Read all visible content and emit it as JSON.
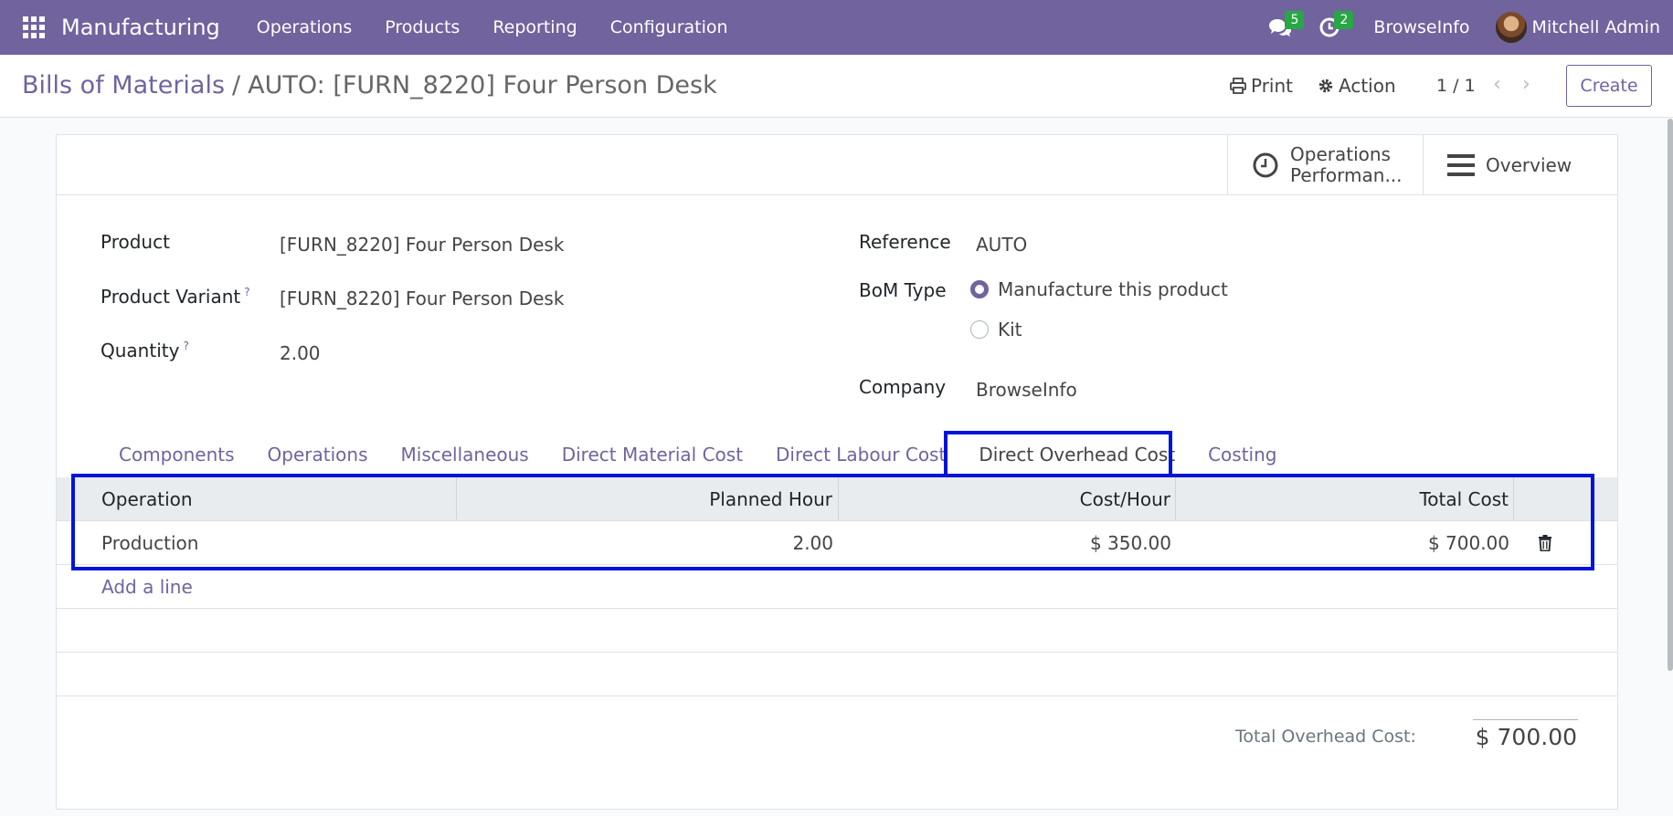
{
  "navbar": {
    "app_name": "Manufacturing",
    "menu": [
      "Operations",
      "Products",
      "Reporting",
      "Configuration"
    ],
    "messages_count": "5",
    "activities_count": "2",
    "company": "BrowseInfo",
    "user": "Mitchell Admin",
    "bg_color": "#71639e"
  },
  "control_panel": {
    "breadcrumb_parent": "Bills of Materials",
    "breadcrumb_separator": "/",
    "breadcrumb_current": "AUTO: [FURN_8220] Four Person Desk",
    "print_label": "Print",
    "action_label": "Action",
    "pager": "1 / 1",
    "create_label": "Create"
  },
  "button_box": {
    "operations_performance_line1": "Operations",
    "operations_performance_line2": "Performan...",
    "overview_label": "Overview"
  },
  "form": {
    "product_label": "Product",
    "product_value": "[FURN_8220] Four Person Desk",
    "variant_label": "Product Variant",
    "variant_value": "[FURN_8220] Four Person Desk",
    "quantity_label": "Quantity",
    "quantity_value": "2.00",
    "help_mark": "?",
    "reference_label": "Reference",
    "reference_value": "AUTO",
    "bom_type_label": "BoM Type",
    "bom_type_options": [
      "Manufacture this product",
      "Kit"
    ],
    "bom_type_selected": "Manufacture this product",
    "company_label": "Company",
    "company_value": "BrowseInfo"
  },
  "tabs": [
    {
      "label": "Components"
    },
    {
      "label": "Operations"
    },
    {
      "label": "Miscellaneous"
    },
    {
      "label": "Direct Material Cost"
    },
    {
      "label": "Direct Labour Cost"
    },
    {
      "label": "Direct Overhead Cost",
      "active": true
    },
    {
      "label": "Costing"
    }
  ],
  "overhead_table": {
    "columns": [
      "Operation",
      "Planned Hour",
      "Cost/Hour",
      "Total Cost"
    ],
    "rows": [
      {
        "operation": "Production",
        "planned_hour": "2.00",
        "cost_hour": "$ 350.00",
        "total_cost": "$ 700.00"
      }
    ],
    "add_line_label": "Add a line"
  },
  "totals": {
    "label": "Total Overhead Cost:",
    "value": "$ 700.00"
  },
  "colors": {
    "accent": "#71639e",
    "highlight": "#0014d9"
  }
}
